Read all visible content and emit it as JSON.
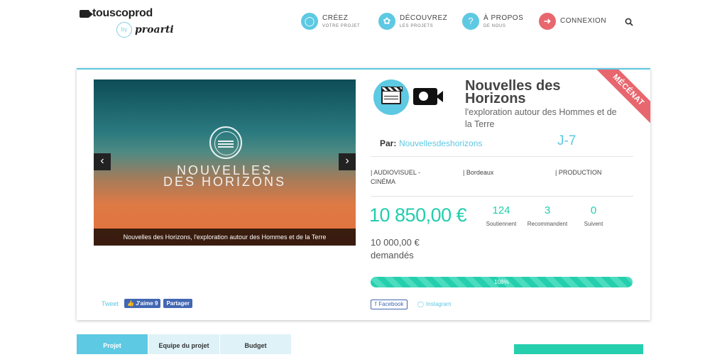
{
  "header": {
    "logo": {
      "brand": "touscoprod",
      "by": "by",
      "partner": "proarti"
    },
    "nav": [
      {
        "main": "CRÉEZ",
        "sub": "VOTRE PROJET",
        "icon": "lightbulb-icon"
      },
      {
        "main": "DÉCOUVREZ",
        "sub": "LES PROJETS",
        "icon": "handshake-icon"
      },
      {
        "main": "À PROPOS",
        "sub": "DE NOUS",
        "icon": "question-icon"
      },
      {
        "main": "CONNEXION",
        "sub": "",
        "icon": "login-icon"
      }
    ],
    "search_icon": "search-icon"
  },
  "ribbon": "MÉCÉNAT",
  "media": {
    "title_line1": "NOUVELLES",
    "title_line2": "DES HORIZONS",
    "caption": "Nouvelles des Horizons, l'exploration autour des Hommes et de la Terre",
    "prev_arrow": "‹",
    "next_arrow": "›"
  },
  "share": {
    "tweet": "Tweet",
    "like": "J'aime 9",
    "partager": "Partager"
  },
  "project": {
    "title": "Nouvelles des Horizons",
    "subtitle": "l'exploration autour des Hommes et de la Terre",
    "par_label": "Par:",
    "author": "Nouvellesdeshorizons",
    "days_left": "J-7",
    "tags": [
      "| AUDIOVISUEL - CINÉMA",
      "| Bordeaux",
      "| PRODUCTION"
    ],
    "amount": "10 850,00 €",
    "requested_amount": "10 000,00 €",
    "requested_label": "demandés",
    "stats": [
      {
        "value": "124",
        "label": "Soutiennent"
      },
      {
        "value": "3",
        "label": "Recommandent"
      },
      {
        "value": "0",
        "label": "Suivent"
      }
    ],
    "progress_percent": 108,
    "progress_label": "108%"
  },
  "social": {
    "facebook": "Facebook",
    "instagram": "Instagram"
  },
  "tabs": [
    "Projet",
    "Equipe du projet",
    "Budget"
  ],
  "colors": {
    "accent": "#5dc9e2",
    "success": "#22cdae",
    "ribbon": "#e8666e",
    "facebook": "#4267b2"
  }
}
